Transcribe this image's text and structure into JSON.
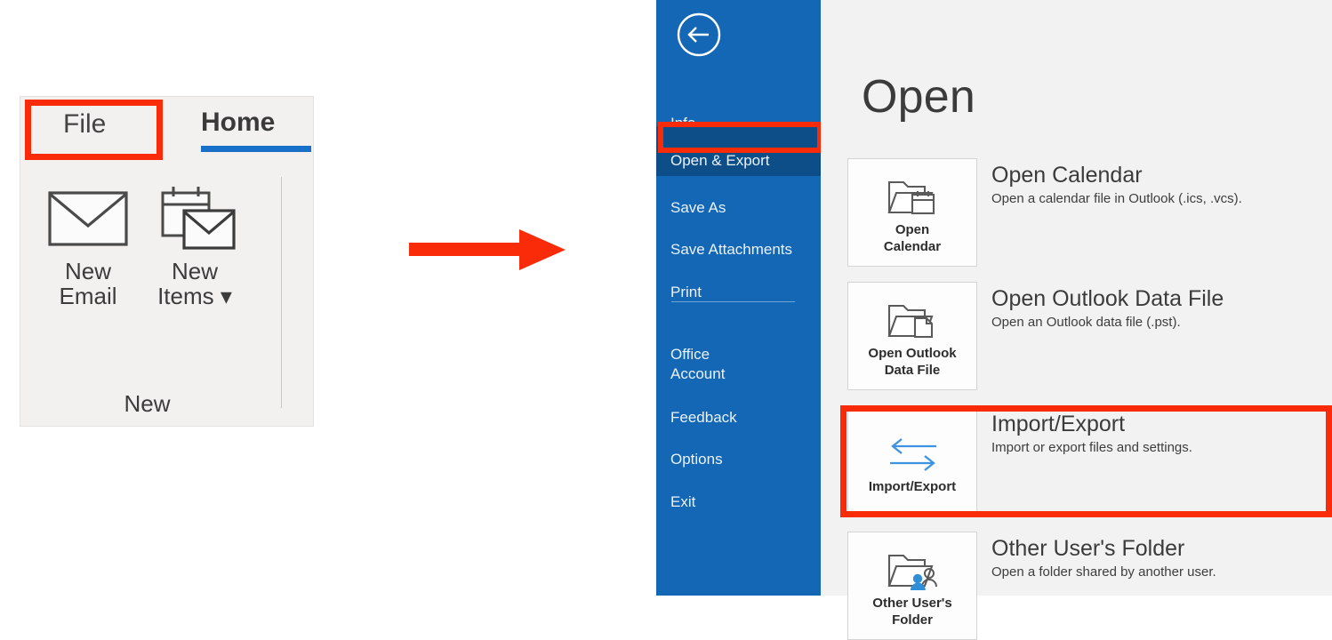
{
  "ribbon": {
    "tabs": [
      {
        "label": "File",
        "name": "tab-file",
        "highlighted": true
      },
      {
        "label": "Home",
        "name": "tab-home",
        "active": true
      }
    ],
    "group_name": "New",
    "buttons": [
      {
        "label": "New\nEmail",
        "icon": "envelope-icon"
      },
      {
        "label": "New\nItems ▾",
        "icon": "calendar-envelope-icon"
      }
    ]
  },
  "flow": {
    "arrow_icon": "right-arrow-icon",
    "arrow_color": "#fa2b08"
  },
  "backstage": {
    "back_button_icon": "back-arrow-icon",
    "sidebar": {
      "items": [
        {
          "label": "Info",
          "selected": false
        },
        {
          "label": "Open & Export",
          "selected": true,
          "highlighted": true
        },
        {
          "label": "Save As",
          "selected": false
        },
        {
          "label": "Save Attachments",
          "selected": false
        },
        {
          "label": "Print",
          "selected": false
        },
        {
          "label": "Office\nAccount",
          "selected": false
        },
        {
          "label": "Feedback",
          "selected": false
        },
        {
          "label": "Options",
          "selected": false
        },
        {
          "label": "Exit",
          "selected": false
        }
      ]
    },
    "heading": "Open",
    "commands": [
      {
        "tile_label": "Open\nCalendar",
        "title": "Open Calendar",
        "description": "Open a calendar file in Outlook (.ics, .vcs).",
        "icon": "folder-calendar-icon",
        "highlighted": false
      },
      {
        "tile_label": "Open Outlook\nData File",
        "title": "Open Outlook Data File",
        "description": "Open an Outlook data file (.pst).",
        "icon": "folder-file-icon",
        "highlighted": false
      },
      {
        "tile_label": "Import/Export",
        "title": "Import/Export",
        "description": "Import or export files and settings.",
        "icon": "import-export-arrows-icon",
        "highlighted": true
      },
      {
        "tile_label": "Other User's\nFolder",
        "title": "Other User's Folder",
        "description": "Open a folder shared by another user.",
        "icon": "folder-user-icon",
        "highlighted": false
      }
    ]
  },
  "colors": {
    "highlight_red": "#fa2b08",
    "office_blue": "#1367b5",
    "selected_blue": "#0d4e89",
    "accent_blue": "#1870c9",
    "panel_gray": "#f2f2f2"
  }
}
